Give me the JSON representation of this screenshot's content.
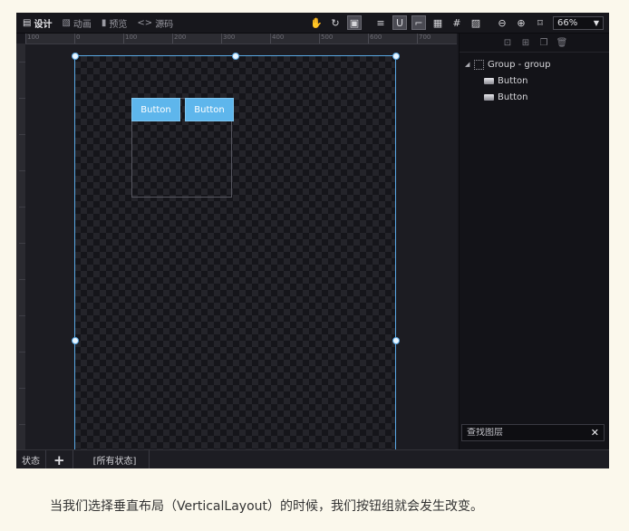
{
  "toolbar": {
    "tabs": [
      {
        "label": "设计",
        "icon": "layout-icon"
      },
      {
        "label": "动画",
        "icon": "animation-icon"
      },
      {
        "label": "预览",
        "icon": "preview-icon"
      },
      {
        "label": "源码",
        "icon": "code-icon"
      }
    ],
    "zoom": "66%"
  },
  "ruler": {
    "labels": [
      "100",
      "0",
      "100",
      "200",
      "300",
      "400",
      "500",
      "600",
      "700"
    ]
  },
  "canvas": {
    "buttons": [
      {
        "label": "Button"
      },
      {
        "label": "Button"
      }
    ]
  },
  "layers": {
    "group_label": "Group - group",
    "items": [
      {
        "label": "Button"
      },
      {
        "label": "Button"
      }
    ],
    "search_placeholder": "查找图层"
  },
  "bottombar": {
    "state_label": "状态",
    "add_label": "+",
    "all_states_label": "[所有状态]"
  },
  "caption": "当我们选择垂直布局（VerticalLayout）的时候，我们按钮组就会发生改变。",
  "colors": {
    "selection": "#5aa9e6",
    "button_bg": "#5eb6ec",
    "page_bg": "#fbf8ec"
  }
}
